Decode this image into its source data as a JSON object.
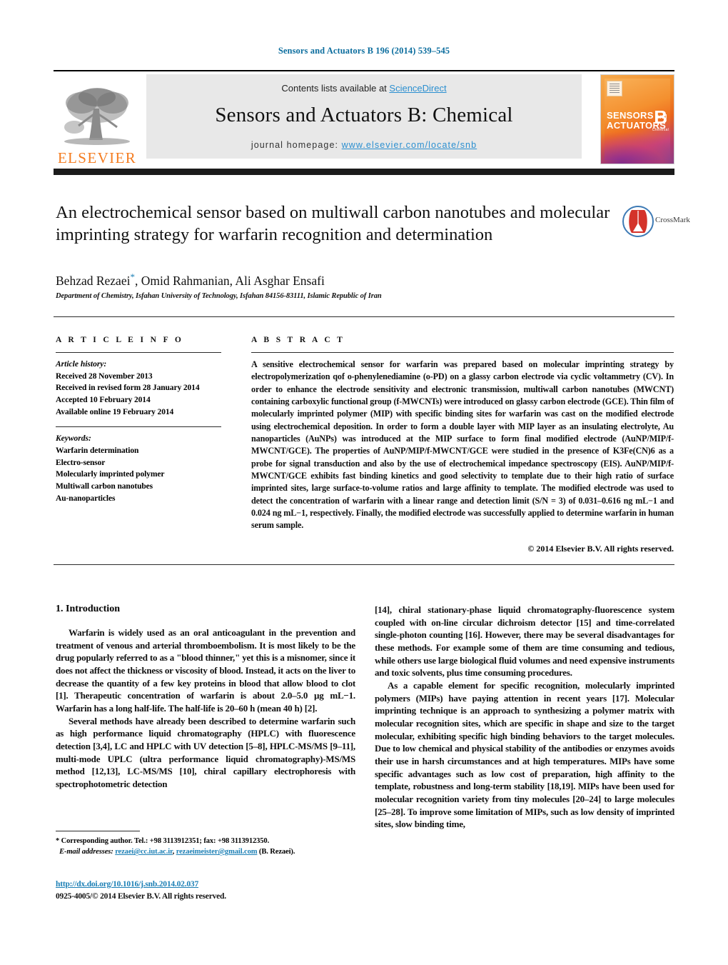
{
  "running_head": "Sensors and Actuators B 196 (2014) 539–545",
  "banner": {
    "contents_prefix": "Contents lists available at ",
    "sciencedirect": "ScienceDirect",
    "journal_title": "Sensors and Actuators B: Chemical",
    "homepage_prefix": "journal homepage: ",
    "homepage_url": "www.elsevier.com/locate/snb",
    "publisher_logo_text": "ELSEVIER",
    "publisher_logo_icon": "elsevier-tree-icon",
    "cover": {
      "line1": "SENSORS",
      "and": "and",
      "line2": "ACTUATORS",
      "volume_letter": "B",
      "subtitle": "Chemical"
    }
  },
  "article": {
    "title": "An electrochemical sensor based on multiwall carbon nanotubes and molecular imprinting strategy for warfarin recognition and determination",
    "crossmark_label": "CrossMark",
    "authors": "Behzad Rezaei",
    "corresponding_mark": "*",
    "authors_rest": ", Omid Rahmanian, Ali Asghar Ensafi",
    "affiliation": "Department of Chemistry, Isfahan University of Technology, Isfahan 84156-83111, Islamic Republic of Iran"
  },
  "article_info": {
    "heading": "A R T I C L E  I N F O",
    "history_label": "Article history:",
    "history": [
      "Received 28 November 2013",
      "Received in revised form 28 January 2014",
      "Accepted 10 February 2014",
      "Available online 19 February 2014"
    ],
    "keywords_label": "Keywords:",
    "keywords": [
      "Warfarin determination",
      "Electro-sensor",
      "Molecularly imprinted polymer",
      "Multiwall carbon nanotubes",
      "Au-nanoparticles"
    ]
  },
  "abstract": {
    "heading": "A B S T R A C T",
    "text": "A sensitive electrochemical sensor for warfarin was prepared based on molecular imprinting strategy by electropolymerization qof o-phenylenediamine (o-PD) on a glassy carbon electrode via cyclic voltammetry (CV). In order to enhance the electrode sensitivity and electronic transmission, multiwall carbon nanotubes (MWCNT) containing carboxylic functional group (f-MWCNTs) were introduced on glassy carbon electrode (GCE). Thin film of molecularly imprinted polymer (MIP) with specific binding sites for warfarin was cast on the modified electrode using electrochemical deposition. In order to form a double layer with MIP layer as an insulating electrolyte, Au nanoparticles (AuNPs) was introduced at the MIP surface to form final modified electrode (AuNP/MIP/f-MWCNT/GCE). The properties of AuNP/MIP/f-MWCNT/GCE were studied in the presence of K3Fe(CN)6 as a probe for signal transduction and also by the use of electrochemical impedance spectroscopy (EIS). AuNP/MIP/f-MWCNT/GCE exhibits fast binding kinetics and good selectivity to template due to their high ratio of surface imprinted sites, large surface-to-volume ratios and large affinity to template. The modified electrode was used to detect the concentration of warfarin with a linear range and detection limit (S/N = 3) of 0.031–0.616 ng mL−1 and 0.024 ng mL−1, respectively. Finally, the modified electrode was successfully applied to determine warfarin in human serum sample.",
    "copyright": "© 2014 Elsevier B.V. All rights reserved."
  },
  "introduction": {
    "heading": "1.  Introduction",
    "left_p1": "Warfarin is widely used as an oral anticoagulant in the prevention and treatment of venous and arterial thromboembolism. It is most likely to be the drug popularly referred to as a \"blood thinner,\" yet this is a misnomer, since it does not affect the thickness or viscosity of blood. Instead, it acts on the liver to decrease the quantity of a few key proteins in blood that allow blood to clot [1]. Therapeutic concentration of warfarin is about 2.0–5.0 µg mL−1. Warfarin has a long half-life. The half-life is 20–60 h (mean 40 h) [2].",
    "left_p2": "Several methods have already been described to determine warfarin such as high performance liquid chromatography (HPLC) with fluorescence detection [3,4], LC and HPLC with UV detection [5–8], HPLC-MS/MS [9–11], multi-mode UPLC (ultra performance liquid chromatography)-MS/MS method [12,13], LC-MS/MS [10], chiral capillary electrophoresis with spectrophotometric detection",
    "right_p1": "[14], chiral stationary-phase liquid chromatography-fluorescence system coupled with on-line circular dichroism detector [15] and time-correlated single-photon counting [16]. However, there may be several disadvantages for these methods. For example some of them are time consuming and tedious, while others use large biological fluid volumes and need expensive instruments and toxic solvents, plus time consuming procedures.",
    "right_p2": "As a capable element for specific recognition, molecularly imprinted polymers (MIPs) have paying attention in recent years [17]. Molecular imprinting technique is an approach to synthesizing a polymer matrix with molecular recognition sites, which are specific in shape and size to the target molecular, exhibiting specific high binding behaviors to the target molecules. Due to low chemical and physical stability of the antibodies or enzymes avoids their use in harsh circumstances and at high temperatures. MIPs have some specific advantages such as low cost of preparation, high affinity to the template, robustness and long-term stability [18,19]. MIPs have been used for molecular recognition variety from tiny molecules [20–24] to large molecules [25–28]. To improve some limitation of MIPs, such as low density of imprinted sites, slow binding time,"
  },
  "footnote": {
    "corresponding": "*  Corresponding author. Tel.: +98 3113912351; fax: +98 3113912350.",
    "email_label": "E-mail addresses:",
    "email1": "rezaei@cc.iut.ac.ir",
    "email_sep": ", ",
    "email2": "rezaeimeister@gmail.com",
    "email_suffix": " (B. Rezaei)."
  },
  "footer": {
    "doi": "http://dx.doi.org/10.1016/j.snb.2014.02.037",
    "issn": "0925-4005/© 2014 Elsevier B.V. All rights reserved."
  },
  "colors": {
    "link": "#1b7fb5",
    "running_head": "#0b6d9e",
    "elsevier_orange": "#F47C20",
    "banner_bg": "#e8e8e8"
  }
}
